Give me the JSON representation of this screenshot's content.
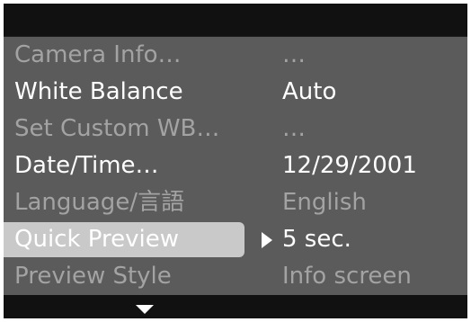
{
  "menu": {
    "items": [
      {
        "label": "Camera Info…",
        "value": "…",
        "state": "dim"
      },
      {
        "label": "White Balance",
        "value": "Auto",
        "state": "bright"
      },
      {
        "label": "Set Custom WB…",
        "value": "…",
        "state": "dim"
      },
      {
        "label": "Date/Time…",
        "value": "12/29/2001",
        "state": "bright"
      },
      {
        "label": "Language/言語",
        "value": "English",
        "state": "dim"
      },
      {
        "label": "Quick Preview",
        "value": "5 sec.",
        "state": "selected"
      },
      {
        "label": "Preview Style",
        "value": "Info screen",
        "state": "dim"
      }
    ]
  },
  "icons": {
    "selection_arrow": "triangle-right-icon",
    "scroll_arrow": "triangle-down-icon"
  },
  "colors": {
    "menu_background": "#5b5b5b",
    "highlight": "#c9c9c9",
    "text_bright": "#ffffff",
    "text_dim": "#a3a3a3",
    "bar_background": "#111111"
  }
}
